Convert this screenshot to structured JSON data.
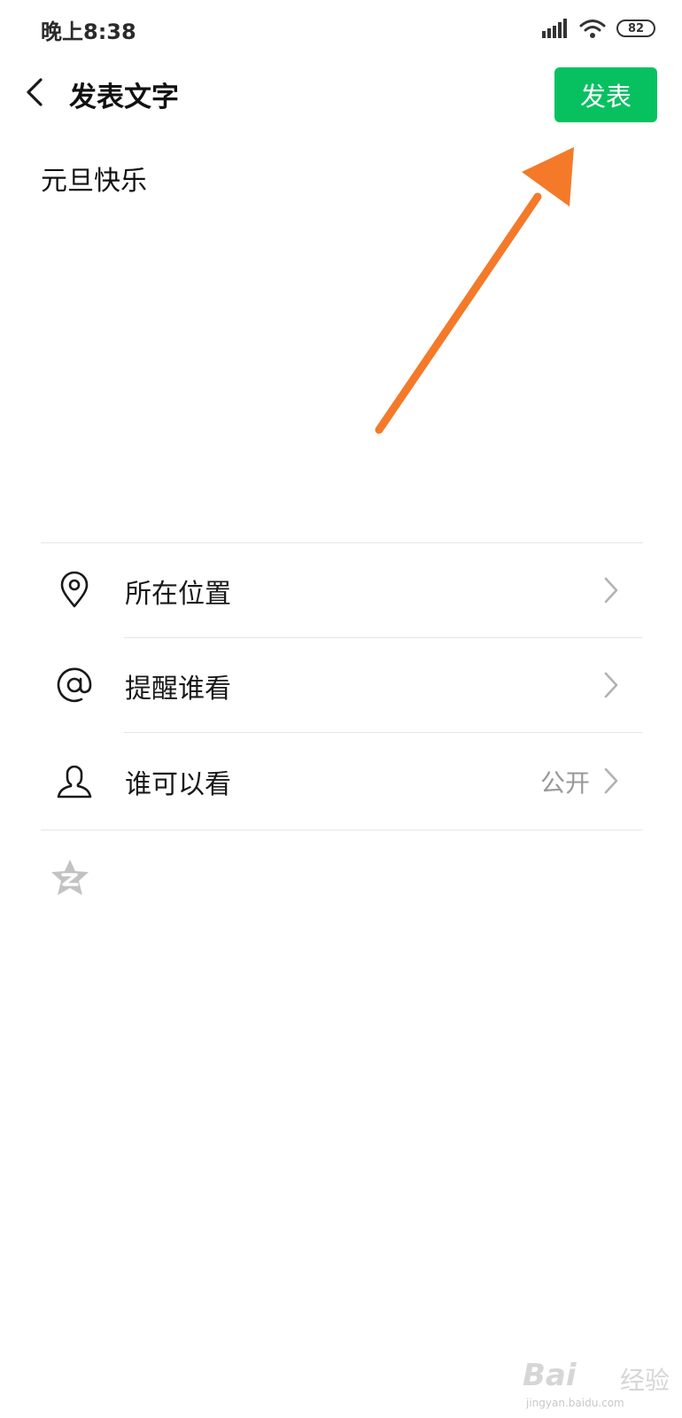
{
  "status_bar": {
    "time": "晚上8:38",
    "battery": "82",
    "icons": [
      "signal-icon",
      "wifi-icon",
      "battery-icon"
    ]
  },
  "nav": {
    "title": "发表文字",
    "publish_label": "发表",
    "back_icon": "chevron-left-icon"
  },
  "post": {
    "text": "元旦快乐"
  },
  "options": [
    {
      "label": "所在位置",
      "icon": "location-pin-icon",
      "value": ""
    },
    {
      "label": "提醒谁看",
      "icon": "at-sign-icon",
      "value": ""
    },
    {
      "label": "谁可以看",
      "icon": "person-icon",
      "value": "公开"
    }
  ],
  "extra": {
    "icon": "qzone-star-icon"
  },
  "colors": {
    "accent": "#07c160",
    "annotation_arrow": "#f47a2a",
    "secondary_text": "#999999",
    "divider": "#e5e5e5"
  },
  "watermark": {
    "brand": "Bai",
    "brand_suffix": "经验",
    "url": "jingyan.baidu.com"
  }
}
